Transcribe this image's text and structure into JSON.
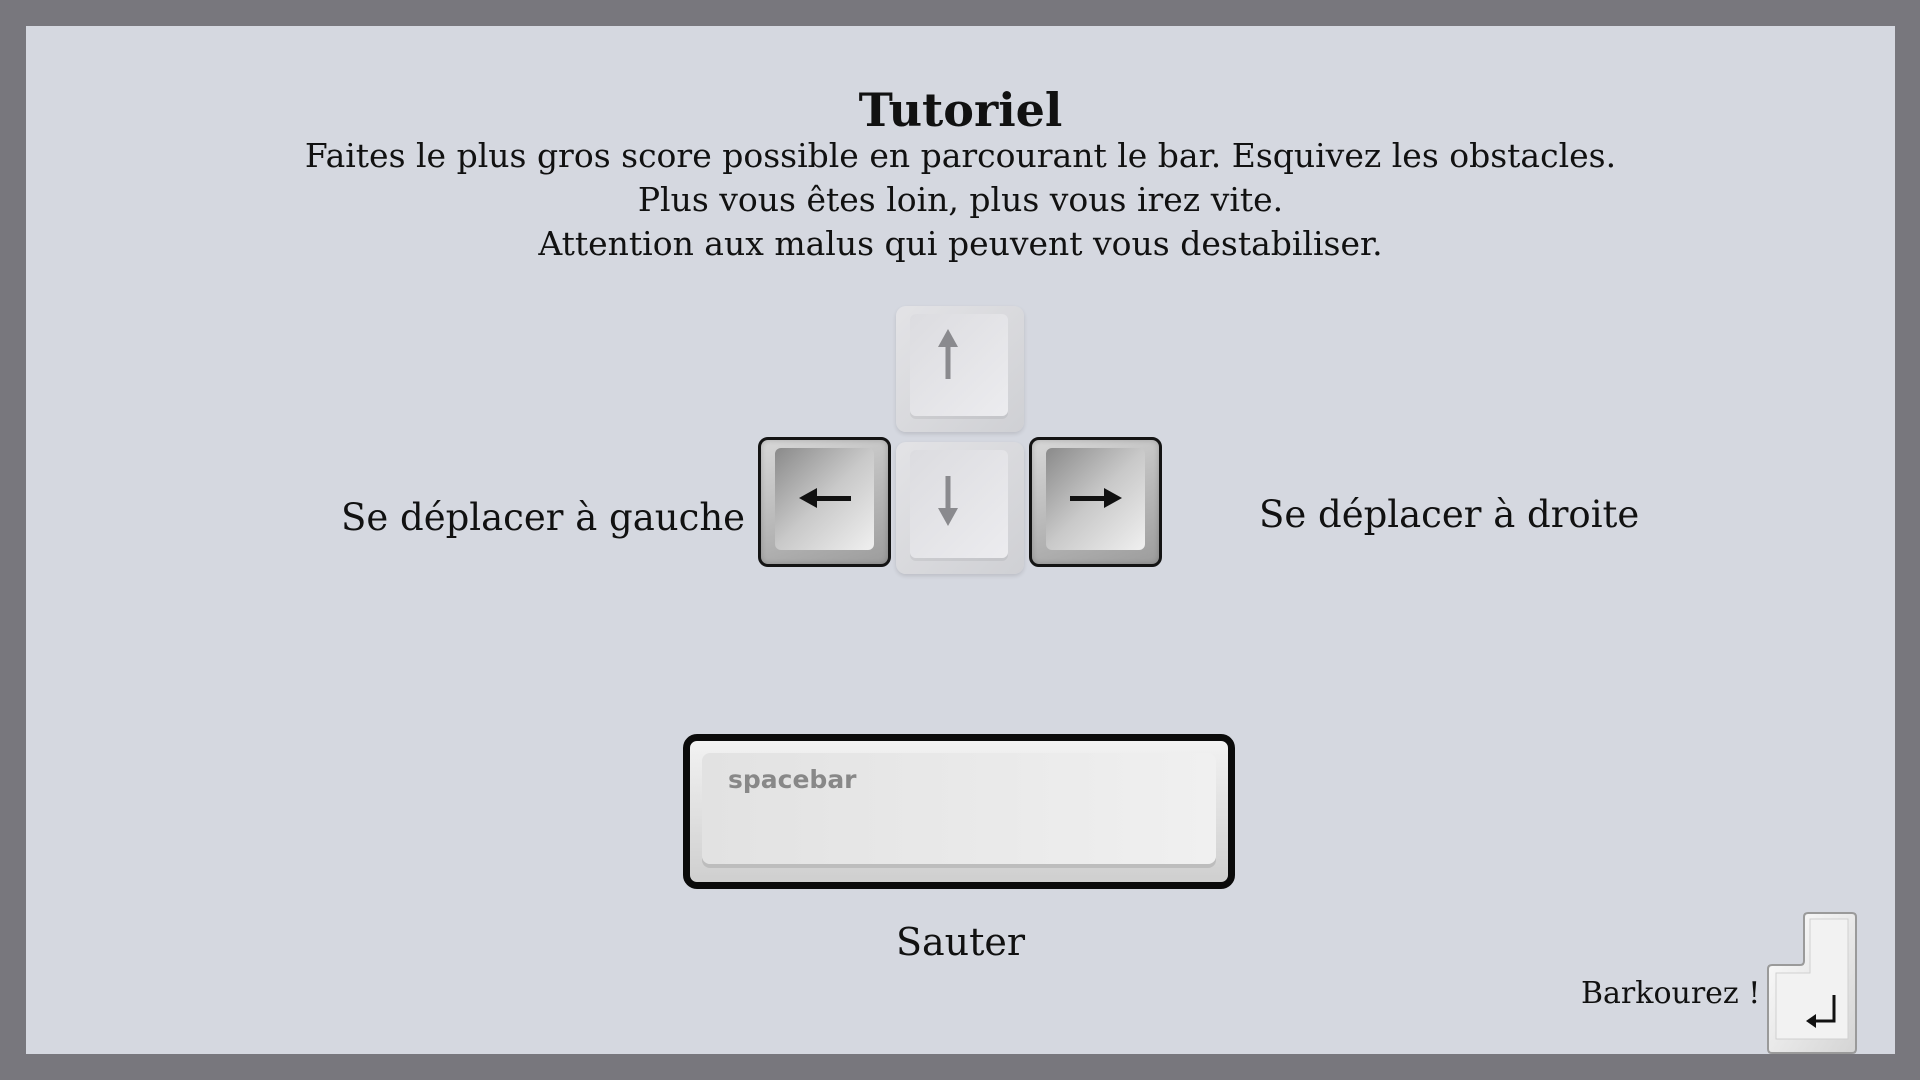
{
  "tutorial": {
    "title": "Tutoriel",
    "lines": [
      "Faites le plus gros score possible en parcourant le bar. Esquivez les obstacles.",
      "Plus vous êtes loin, plus vous irez vite.",
      "Attention aux malus qui peuvent vous destabiliser."
    ]
  },
  "controls": {
    "left_label": "Se déplacer à gauche",
    "right_label": "Se déplacer à droite",
    "jump_label": "Sauter",
    "spacebar_text": "spacebar",
    "keys": {
      "up": "arrow-up-icon",
      "down": "arrow-down-icon",
      "left": "arrow-left-icon",
      "right": "arrow-right-icon",
      "enter": "enter-return-icon"
    }
  },
  "footer": {
    "start_label": "Barkourez !"
  },
  "colors": {
    "frame": "#78777d",
    "panel": "#d5d8e0",
    "text": "#111111"
  }
}
